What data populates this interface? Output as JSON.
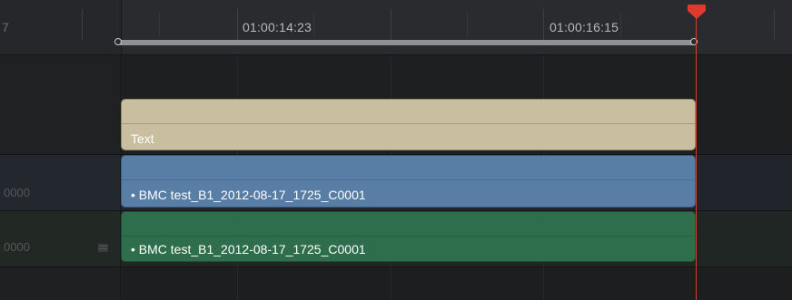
{
  "ruler": {
    "cut_timecode": "7",
    "timecodes": [
      "01:00:14:23",
      "01:00:16:15"
    ]
  },
  "tracks": {
    "v1": {
      "number": "0000"
    },
    "a1": {
      "number": "0000"
    }
  },
  "clips": {
    "text": {
      "label": "Text",
      "color": "#c9bfa0"
    },
    "video": {
      "label": "• BMC test_B1_2012-08-17_1725_C0001",
      "color": "#597ea6"
    },
    "audio": {
      "label": "• BMC test_B1_2012-08-17_1725_C0001",
      "color": "#2f6e4c"
    }
  },
  "playhead": {
    "color": "#e03a2f"
  },
  "icons": {
    "playhead": "playhead-marker-icon",
    "lock": "track-lock-icon"
  }
}
